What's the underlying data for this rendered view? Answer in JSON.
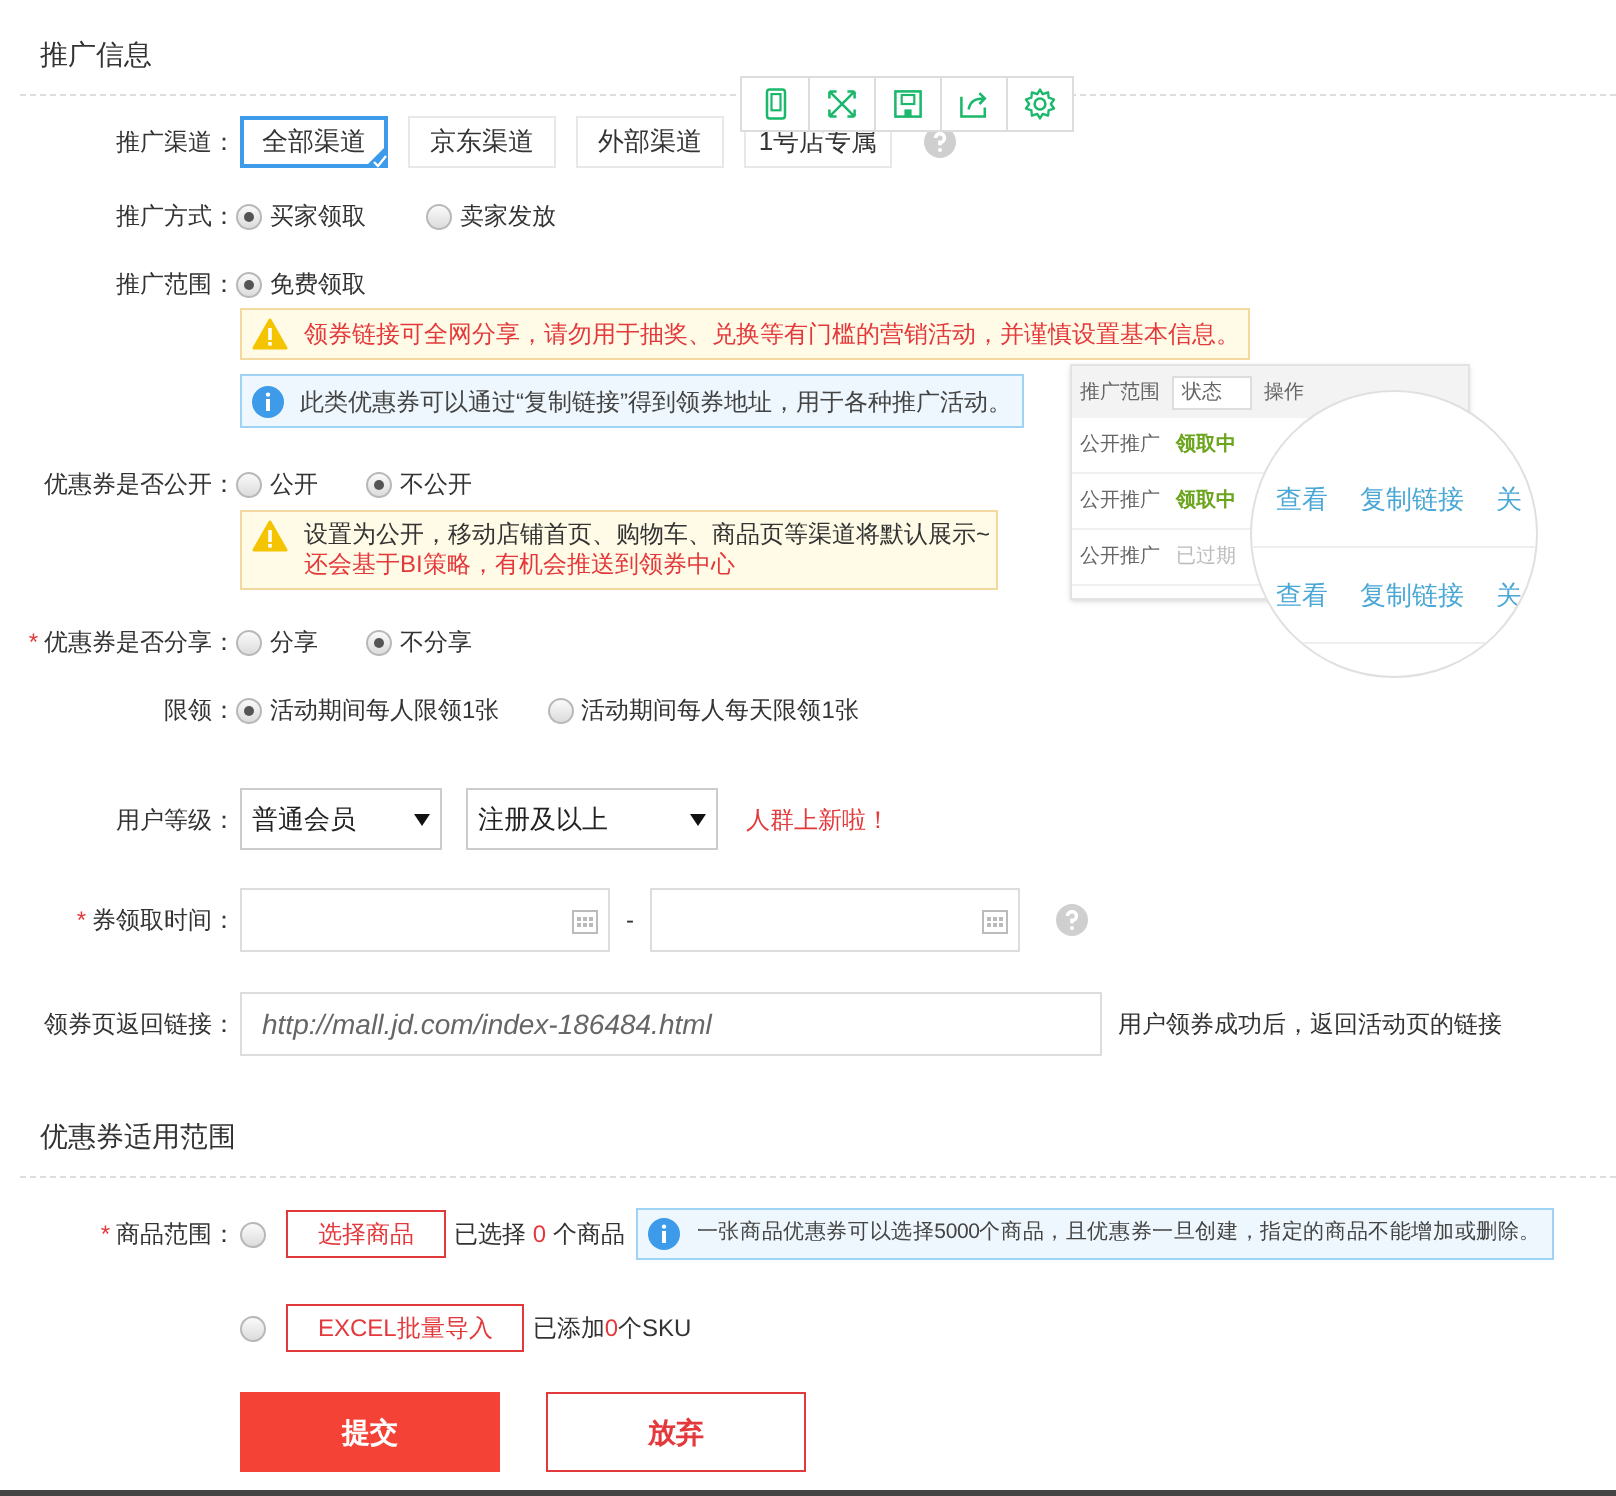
{
  "section_promo": {
    "title": "推广信息"
  },
  "channels": {
    "label": "推广渠道：",
    "options": [
      {
        "label": "全部渠道",
        "selected": true
      },
      {
        "label": "京东渠道",
        "selected": false
      },
      {
        "label": "外部渠道",
        "selected": false
      },
      {
        "label": "1号店专属",
        "selected": false
      }
    ]
  },
  "method": {
    "label": "推广方式：",
    "options": [
      {
        "label": "买家领取",
        "selected": true
      },
      {
        "label": "卖家发放",
        "selected": false
      }
    ]
  },
  "scope": {
    "label": "推广范围：",
    "options": [
      {
        "label": "免费领取",
        "selected": true
      }
    ],
    "warning": "领券链接可全网分享，请勿用于抽奖、兑换等有门槛的营销活动，并谨慎设置基本信息。",
    "info": "此类优惠券可以通过“复制链接”得到领券地址，用于各种推广活动。"
  },
  "preview": {
    "header": [
      "推广范围",
      "状态",
      "操作"
    ],
    "rows": [
      {
        "channel": "公开推广",
        "status": "领取中",
        "active": true
      },
      {
        "channel": "公开推广",
        "status": "领取中",
        "active": true
      },
      {
        "channel": "公开推广",
        "status": "已过期",
        "active": false
      }
    ],
    "zoom_rows": [
      [
        "查看",
        "复制链接",
        "关"
      ],
      [
        "查看",
        "复制链接",
        "关"
      ]
    ]
  },
  "public": {
    "label": "优惠券是否公开：",
    "options": [
      {
        "label": "公开",
        "selected": false
      },
      {
        "label": "不公开",
        "selected": true
      }
    ],
    "note": "设置为公开，移动店铺首页、购物车、商品页等渠道将默认展示~",
    "note_red": "还会基于BI策略，有机会推送到领券中心"
  },
  "share": {
    "label": "优惠券是否分享：",
    "required_mark": "*",
    "options": [
      {
        "label": "分享",
        "selected": false
      },
      {
        "label": "不分享",
        "selected": true
      }
    ]
  },
  "limit": {
    "label": "限领：",
    "options": [
      {
        "label": "活动期间每人限领1张",
        "selected": true
      },
      {
        "label": "活动期间每人每天限领1张",
        "selected": false
      }
    ]
  },
  "user_level": {
    "label": "用户等级：",
    "selects": [
      "普通会员",
      "注册及以上"
    ],
    "badge": "人群上新啦！"
  },
  "time": {
    "label": "券领取时间：",
    "required_mark": "*",
    "separator": "-"
  },
  "return_link": {
    "label": "领券页返回链接：",
    "placeholder": "http://mall.jd.com/index-186484.html",
    "hint": "用户领券成功后，返回活动页的链接"
  },
  "section_scope": {
    "title": "优惠券适用范围"
  },
  "goods": {
    "label": "商品范围：",
    "required_mark": "*",
    "options": [
      {
        "selected": false,
        "button": "选择商品",
        "before": "已选择 ",
        "count": "0",
        "after": " 个商品"
      },
      {
        "selected": false,
        "button": "EXCEL批量导入",
        "before": "已添加",
        "count": "0",
        "after": "个SKU"
      }
    ],
    "info": "一张商品优惠券可以选择5000个商品，且优惠券一旦创建，指定的商品不能增加或删除。"
  },
  "actions": {
    "submit": "提交",
    "cancel": "放弃"
  }
}
